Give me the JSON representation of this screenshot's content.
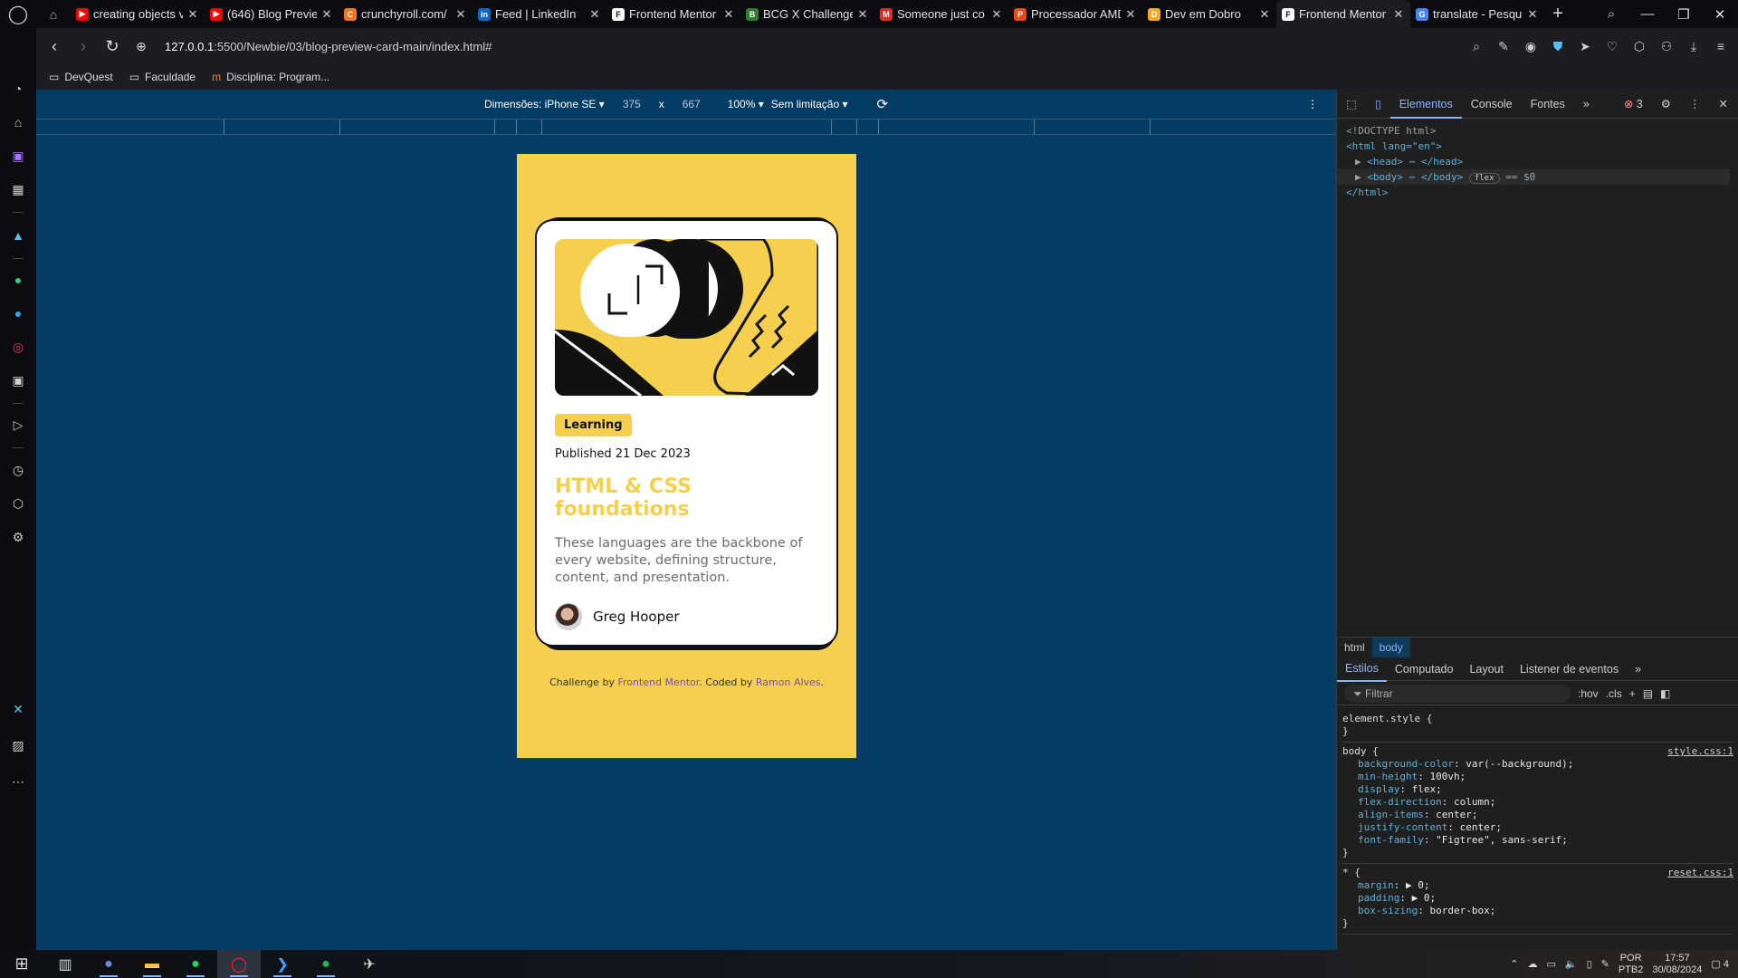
{
  "tabs": [
    {
      "title": "creating objects v",
      "fav": "▶",
      "color": "#ff0000"
    },
    {
      "title": "(646) Blog Previe",
      "fav": "▶",
      "color": "#ff0000"
    },
    {
      "title": "crunchyroll.com/",
      "fav": "C",
      "color": "#f47521"
    },
    {
      "title": "Feed | LinkedIn",
      "fav": "in",
      "color": "#0a66c2"
    },
    {
      "title": "Frontend Mentor",
      "fav": "F",
      "color": "#ffffff"
    },
    {
      "title": "BCG X Challenge",
      "fav": "B",
      "color": "#2e7d32"
    },
    {
      "title": "Someone just co",
      "fav": "M",
      "color": "#d93025"
    },
    {
      "title": "Processador AMD",
      "fav": "P",
      "color": "#e64a19"
    },
    {
      "title": "Dev em Dobro",
      "fav": "D",
      "color": "#f9a825"
    },
    {
      "title": "Frontend Mentor",
      "fav": "F",
      "color": "#ffffff",
      "active": true
    },
    {
      "title": "translate - Pesqui",
      "fav": "G",
      "color": "#4285f4"
    }
  ],
  "address": {
    "host": "127.0.0.1",
    "path": ":5500/Newbie/03/blog-preview-card-main/index.html#"
  },
  "bookmarks": [
    "DevQuest",
    "Faculdade",
    "Disciplina: Program..."
  ],
  "device_toolbar": {
    "dimensions_label": "Dimensões: iPhone SE",
    "width": "375",
    "times": "x",
    "height": "667",
    "zoom": "100%",
    "throttle": "Sem limitação"
  },
  "card": {
    "tag": "Learning",
    "published": "Published 21 Dec 2023",
    "title": "HTML & CSS foundations",
    "description": "These languages are the backbone of every website, defining structure, content, and presentation.",
    "author": "Greg Hooper"
  },
  "attribution": {
    "prefix": "Challenge by ",
    "fm": "Frontend Mentor",
    "mid": ". Coded by ",
    "author": "Ramon Alves",
    "suffix": "."
  },
  "devtools": {
    "tabs": [
      "Elementos",
      "Console",
      "Fontes"
    ],
    "more": "»",
    "errors": "3",
    "dom": {
      "doctype": "<!DOCTYPE html>",
      "html_open": "<html lang=\"en\">",
      "head": "<head> ⋯ </head>",
      "body": "<body> ⋯ </body>",
      "flex_badge": "flex",
      "eq": "== $0",
      "html_close": "</html>"
    },
    "breadcrumbs": [
      "html",
      "body"
    ],
    "style_tabs": [
      "Estilos",
      "Computado",
      "Layout",
      "Listener de eventos"
    ],
    "filter_placeholder": "Filtrar",
    "hov": ":hov",
    "cls": ".cls",
    "rules": [
      {
        "selector": "element.style {",
        "source": "",
        "props": [],
        "close": "}"
      },
      {
        "selector": "body {",
        "source": "style.css:1",
        "props": [
          [
            "background-color",
            "var(--background);"
          ],
          [
            "min-height",
            "100vh;"
          ],
          [
            "display",
            "flex;"
          ],
          [
            "flex-direction",
            "column;"
          ],
          [
            "align-items",
            "center;"
          ],
          [
            "justify-content",
            "center;"
          ],
          [
            "font-family",
            "\"Figtree\", sans-serif;"
          ]
        ],
        "close": "}"
      },
      {
        "selector": "* {",
        "source": "reset.css:1",
        "props": [
          [
            "margin",
            "▶ 0;"
          ],
          [
            "padding",
            "▶ 0;"
          ],
          [
            "box-sizing",
            "border-box;"
          ]
        ],
        "close": "}"
      }
    ]
  },
  "tray": {
    "lang": "POR",
    "layout": "PTB2",
    "time": "17:57",
    "date": "30/08/2024",
    "notif": "4"
  },
  "colors": {
    "page_bg": "#043c63",
    "card_yellow": "#f4d04e",
    "accent_link": "#7b4fa5"
  }
}
